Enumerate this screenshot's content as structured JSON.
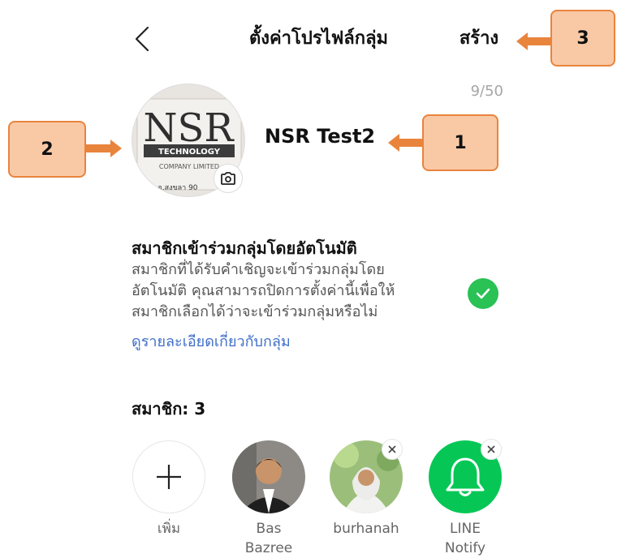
{
  "header": {
    "title": "ตั้งค่าโปรไฟล์กลุ่ม",
    "create_label": "สร้าง"
  },
  "profile": {
    "name_counter": "9/50",
    "group_name": "NSR Test2",
    "avatar_text": {
      "logo": "NSR",
      "line1": "TECHNOLOGY",
      "line2": "COMPANY LIMITED",
      "line3": "จ.สงขลา 90"
    }
  },
  "auto_join": {
    "title": "สมาชิกเข้าร่วมกลุ่มโดยอัตโนมัติ",
    "desc_lines": [
      "สมาชิกที่ได้รับคำเชิญจะเข้าร่วมกลุ่มโดย",
      "อัตโนมัติ คุณสามารถปิดการตั้งค่านี้เพื่อให้",
      "สมาชิกเลือกได้ว่าจะเข้าร่วมกลุ่มหรือไม่"
    ],
    "link": "ดูรายละเอียดเกี่ยวกับกลุ่ม",
    "checked": true
  },
  "members": {
    "label": "สมาชิก: 3",
    "add_label": "เพิ่ม",
    "list": [
      {
        "name_line1": "Bas",
        "name_line2": "Bazree",
        "removable": false
      },
      {
        "name_line1": "burhanah",
        "name_line2": "",
        "removable": true
      },
      {
        "name_line1": "LINE",
        "name_line2": "Notify",
        "removable": true
      }
    ]
  },
  "callouts": {
    "c1": "1",
    "c2": "2",
    "c3": "3"
  },
  "colors": {
    "accent_green": "#2ac155",
    "line_notify_green": "#06c755",
    "link_blue": "#3e6ec8",
    "callout_fill": "#f9c9a6",
    "callout_arrow": "#e9843d"
  },
  "icons": {
    "back": "chevron-left-icon",
    "camera": "camera-icon",
    "check": "check-icon",
    "add": "plus-icon",
    "remove": "close-icon",
    "bell": "bell-icon"
  }
}
